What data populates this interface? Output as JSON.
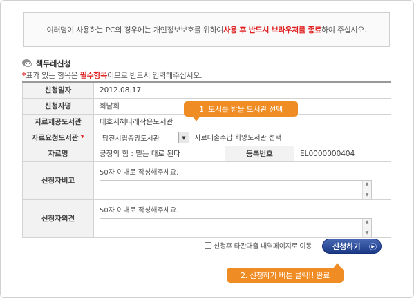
{
  "notice": {
    "text_before": "여러명이 사용하는 PC의 경우에는 개인정보보호를 위하여 ",
    "text_highlight": "사용 후 반드시 브라우저를 종료",
    "text_after": "하여 주십시오."
  },
  "section": {
    "title": "책두레신청"
  },
  "required_note": {
    "star": "*",
    "part1": "표가 있는 항목은 ",
    "highlight": "필수항목",
    "part2": "이므로 반드시 입력해주십시오."
  },
  "form": {
    "apply_date": {
      "label": "신청일자",
      "value": "2012.08.17"
    },
    "applicant": {
      "label": "신청자명",
      "value": "희남희"
    },
    "provider_library": {
      "label": "자료제공도서관",
      "value": "태호지혜나래작은도서관"
    },
    "request_library": {
      "label": "자료요청도서관",
      "star": "*",
      "selected": "당진시립중앙도서관",
      "note": "자료대출수납 희망도서관 선택"
    },
    "material": {
      "label": "자료명",
      "value": "긍정의 힘 : 믿는 대로 된다",
      "reg_label": "등록번호",
      "reg_value": "EL0000000404"
    },
    "remarks": {
      "label": "신청자비고",
      "hint": "50자 이내로 작성해주세요."
    },
    "opinion": {
      "label": "신청자의견",
      "hint": "50자 이내로 작성해주세요."
    }
  },
  "actions": {
    "checkbox_label": "신청후 타관대출 내역페이지로 이동",
    "submit_label": "신청하기"
  },
  "callouts": {
    "step1": "1. 도서를 받을 도서관 선택",
    "step2": "2. 신청하기 버튼 클릭!! 완료"
  },
  "colors": {
    "accent_red": "#e02020",
    "callout_orange": "#f08c24",
    "button_blue": "#1c3a85"
  }
}
